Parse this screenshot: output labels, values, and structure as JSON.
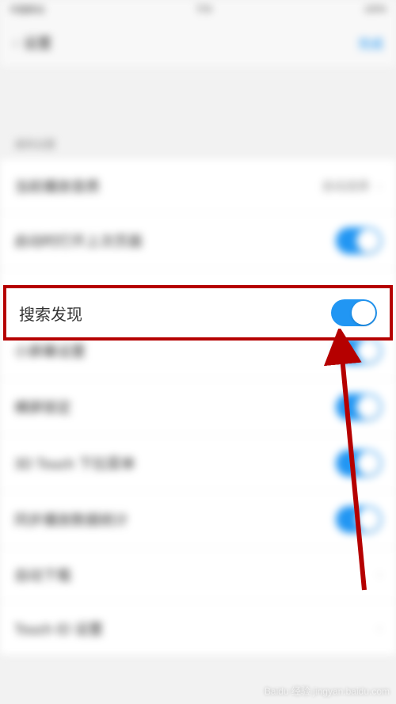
{
  "status": {
    "left": "中国移动",
    "center": "下午",
    "right": "100%"
  },
  "nav": {
    "back": "‹",
    "title": "设置",
    "action": "完成"
  },
  "section": {
    "header": "通用设置"
  },
  "rows": {
    "r0": {
      "label": "当前播放音质",
      "detail": "自动选择"
    },
    "r1": {
      "label": "启动时打开上次页面"
    },
    "highlight": {
      "label": "搜索发现"
    },
    "r3": {
      "label": "小屏幕设置"
    },
    "r4": {
      "label": "横屏锁定"
    },
    "r5": {
      "label": "3D Touch 下拉菜单"
    },
    "r6": {
      "label": "同步播放数据统计"
    },
    "r7": {
      "label": "自动下载"
    },
    "r8": {
      "label": "Touch ID 设置"
    }
  },
  "watermark": "Baidu 经验 jingyan.baidu.com"
}
